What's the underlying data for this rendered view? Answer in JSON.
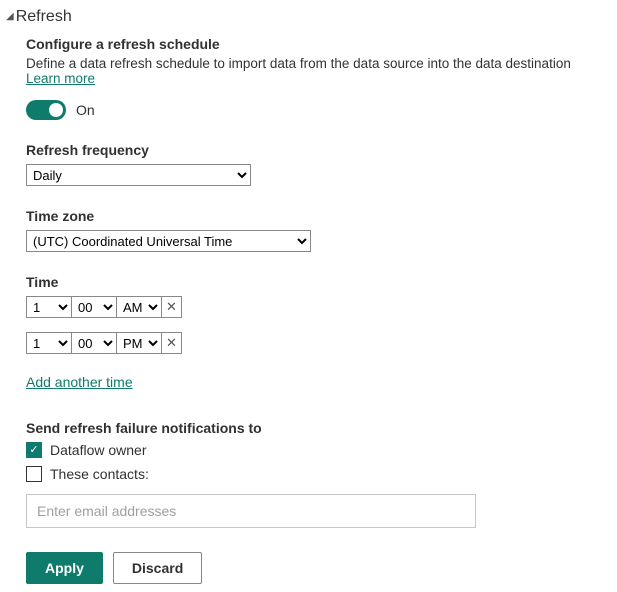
{
  "section": {
    "title": "Refresh"
  },
  "header": {
    "subtitle": "Configure a refresh schedule",
    "description": "Define a data refresh schedule to import data from the data source into the data destination ",
    "learn_more": "Learn more"
  },
  "toggle": {
    "state": true,
    "label": "On"
  },
  "frequency": {
    "label": "Refresh frequency",
    "value": "Daily"
  },
  "timezone": {
    "label": "Time zone",
    "value": "(UTC) Coordinated Universal Time"
  },
  "time": {
    "label": "Time",
    "rows": [
      {
        "hour": "1",
        "minute": "00",
        "ampm": "AM"
      },
      {
        "hour": "1",
        "minute": "00",
        "ampm": "PM"
      }
    ],
    "add_link": "Add another time"
  },
  "notify": {
    "label": "Send refresh failure notifications to",
    "owner": {
      "checked": true,
      "label": "Dataflow owner"
    },
    "contacts": {
      "checked": false,
      "label": "These contacts:"
    },
    "email_placeholder": "Enter email addresses"
  },
  "buttons": {
    "apply": "Apply",
    "discard": "Discard"
  }
}
